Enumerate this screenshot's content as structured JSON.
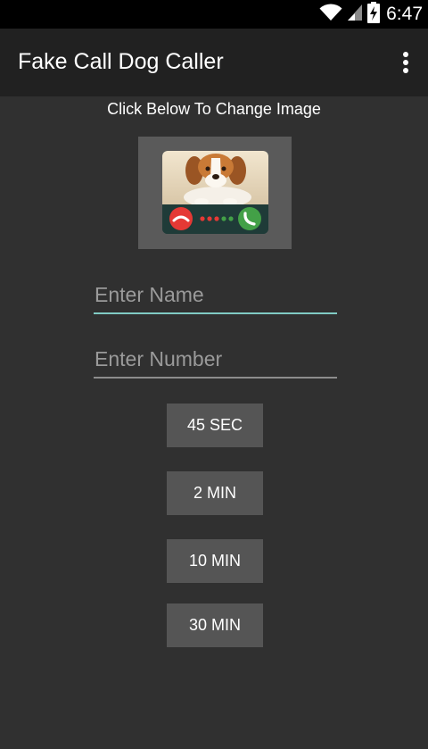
{
  "status_bar": {
    "time": "6:47",
    "icons": [
      "wifi-icon",
      "signal-icon",
      "battery-charging-icon"
    ]
  },
  "app_bar": {
    "title": "Fake Call Dog Caller",
    "overflow_icon": "more-vertical-icon"
  },
  "main": {
    "instruction": "Click Below To Change Image",
    "caller_image": "beagle-puppy-incoming-call-image",
    "name_placeholder": "Enter Name",
    "number_placeholder": "Enter Number",
    "buttons": [
      {
        "label": "45 SEC"
      },
      {
        "label": "2 MIN"
      },
      {
        "label": "10 MIN"
      },
      {
        "label": "30 MIN"
      }
    ]
  },
  "colors": {
    "background": "#303030",
    "app_bar": "#212121",
    "status_bar": "#000000",
    "accent": "#80cbc4",
    "button": "#555555",
    "decline": "#e53935",
    "accept": "#43a047"
  }
}
